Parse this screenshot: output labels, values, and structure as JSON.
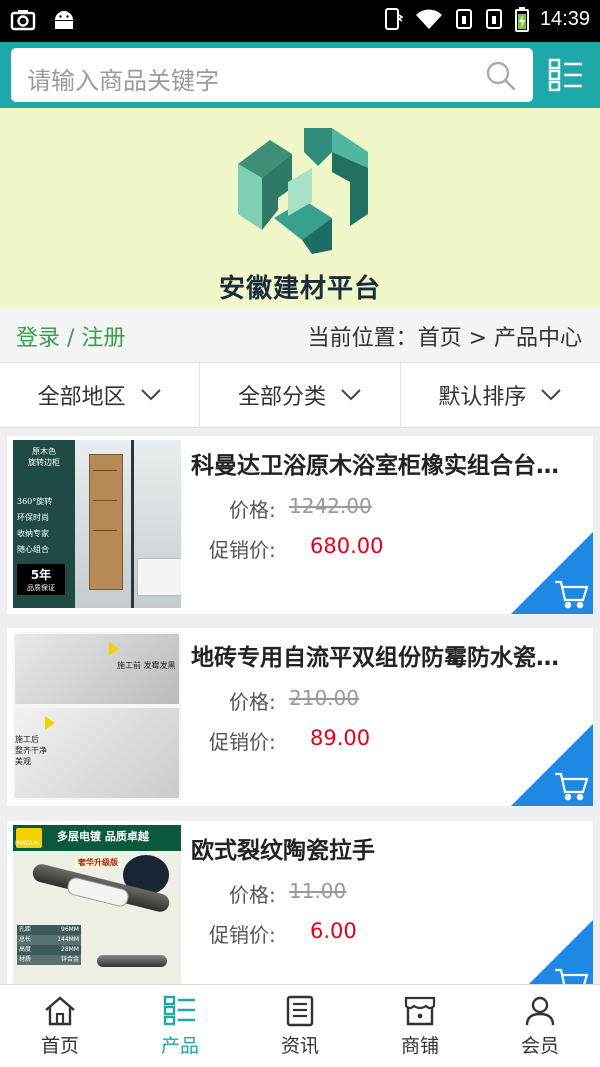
{
  "status_bar": {
    "time": "14:39"
  },
  "search": {
    "placeholder": "请输入商品关键字"
  },
  "banner": {
    "brand_name": "安徽建材平台"
  },
  "breadcrumb_bar": {
    "login_label": "登录 / 注册",
    "location": "当前位置：首页 > 产品中心"
  },
  "filters": [
    {
      "label": "全部地区"
    },
    {
      "label": "全部分类"
    },
    {
      "label": "默认排序"
    }
  ],
  "products": [
    {
      "title": "科曼达卫浴原木浴室柜橡实组合台…",
      "price_label": "价格:",
      "price": "1242.00",
      "promo_label": "促销价:",
      "promo_price": "680.00",
      "thumb_text": [
        "原木色",
        "旋转边柜",
        "360°旋转",
        "环保时尚",
        "收纳专家",
        "随心组合",
        "5年",
        "品质保证"
      ]
    },
    {
      "title": "地砖专用自流平双组份防霉防水瓷…",
      "price_label": "价格:",
      "price": "210.00",
      "promo_label": "促销价:",
      "promo_price": "89.00",
      "thumb_text": [
        "施工前 发霉发黑",
        "施工后",
        "整齐干净",
        "美观"
      ]
    },
    {
      "title": "欧式裂纹陶瓷拉手",
      "price_label": "价格:",
      "price": "11.00",
      "promo_label": "促销价:",
      "promo_price": "6.00",
      "thumb_text": [
        "多层电镀 品质卓越",
        "INNDUN",
        "奢华升级版",
        "孔距",
        "96MM",
        "总长",
        "144MM",
        "高度",
        "28MM",
        "材质",
        "锌合金"
      ]
    }
  ],
  "tabs": [
    {
      "label": "首页",
      "icon": "home-icon"
    },
    {
      "label": "产品",
      "icon": "product-list-icon",
      "active": true
    },
    {
      "label": "资讯",
      "icon": "news-icon"
    },
    {
      "label": "商铺",
      "icon": "shop-icon"
    },
    {
      "label": "会员",
      "icon": "member-icon"
    }
  ],
  "colors": {
    "accent": "#1ea8a9",
    "promo": "#e5001c",
    "cart": "#1e88e5",
    "login": "#3aa04a"
  }
}
